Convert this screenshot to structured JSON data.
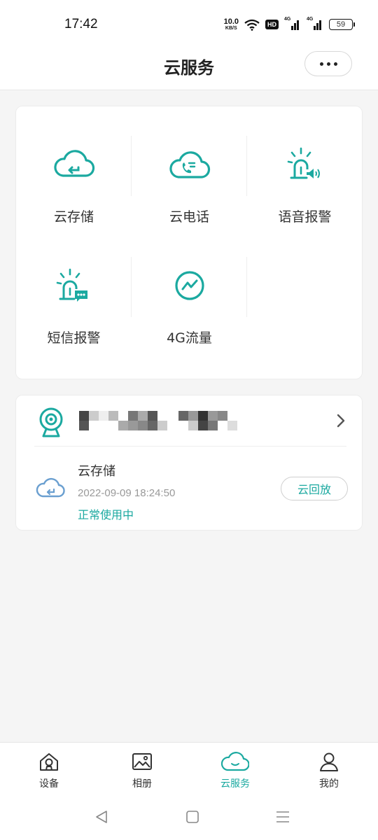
{
  "status_bar": {
    "time": "17:42",
    "net_speed_value": "10.0",
    "net_speed_unit": "KB/S",
    "hd_label": "HD",
    "signal1_label": "4G",
    "signal2_label": "4G",
    "battery": "59"
  },
  "header": {
    "title": "云服务"
  },
  "services": [
    {
      "label": "云存储",
      "icon": "cloud-storage-icon"
    },
    {
      "label": "云电话",
      "icon": "cloud-phone-icon"
    },
    {
      "label": "语音报警",
      "icon": "voice-alarm-icon"
    },
    {
      "label": "短信报警",
      "icon": "sms-alarm-icon"
    },
    {
      "label": "4G流量",
      "icon": "data-traffic-icon"
    }
  ],
  "device": {
    "storage_title": "云存储",
    "storage_date": "2022-09-09 18:24:50",
    "storage_status": "正常使用中",
    "playback_label": "云回放"
  },
  "tabs": [
    {
      "label": "设备",
      "icon": "home-camera-icon",
      "active": false
    },
    {
      "label": "相册",
      "icon": "album-icon",
      "active": false
    },
    {
      "label": "云服务",
      "icon": "cloud-icon",
      "active": true
    },
    {
      "label": "我的",
      "icon": "person-icon",
      "active": false
    }
  ],
  "colors": {
    "accent": "#1ba9a0",
    "storage_icon": "#6a9fd0"
  }
}
